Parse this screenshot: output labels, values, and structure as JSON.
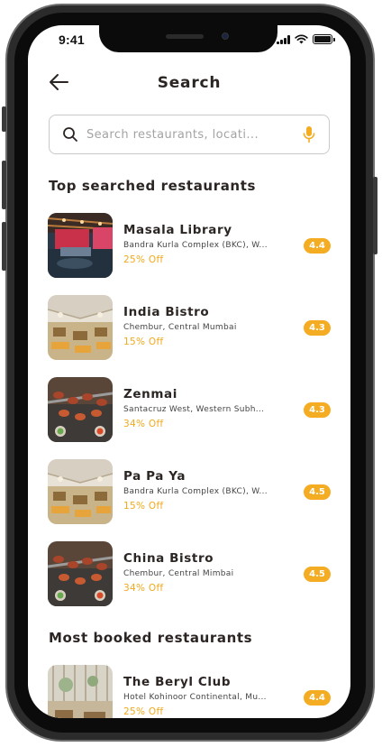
{
  "status_bar": {
    "time": "9:41"
  },
  "header": {
    "title": "Search"
  },
  "search": {
    "placeholder": "Search restaurants, locati..."
  },
  "sections": {
    "top_searched": "Top searched restaurants",
    "most_booked": "Most booked restaurants"
  },
  "top_searched": [
    {
      "name": "Masala Library",
      "address": "Bandra Kurla Complex (BKC), W...",
      "offer": "25% Off",
      "rating": "4.4",
      "image": "restaurant-interior-red"
    },
    {
      "name": "India Bistro",
      "address": "Chembur, Central Mumbai",
      "offer": "15% Off",
      "rating": "4.3",
      "image": "restaurant-interior-light"
    },
    {
      "name": "Zenmai",
      "address": "Santacruz West, Western Subh...",
      "offer": "34% Off",
      "rating": "4.3",
      "image": "grilled-skewers"
    },
    {
      "name": "Pa Pa Ya",
      "address": "Bandra Kurla Complex (BKC), W...",
      "offer": "15% Off",
      "rating": "4.5",
      "image": "restaurant-interior-light"
    },
    {
      "name": "China Bistro",
      "address": "Chembur, Central Mimbai",
      "offer": "34% Off",
      "rating": "4.5",
      "image": "grilled-skewers"
    }
  ],
  "most_booked": [
    {
      "name": "The Beryl Club",
      "address": "Hotel Kohinoor Continental, Mu...",
      "offer": "25% Off",
      "rating": "4.4",
      "image": "club-interior"
    }
  ],
  "colors": {
    "accent": "#f4ac22",
    "offer_text": "#f2a91c",
    "title_text": "#2b2523"
  }
}
